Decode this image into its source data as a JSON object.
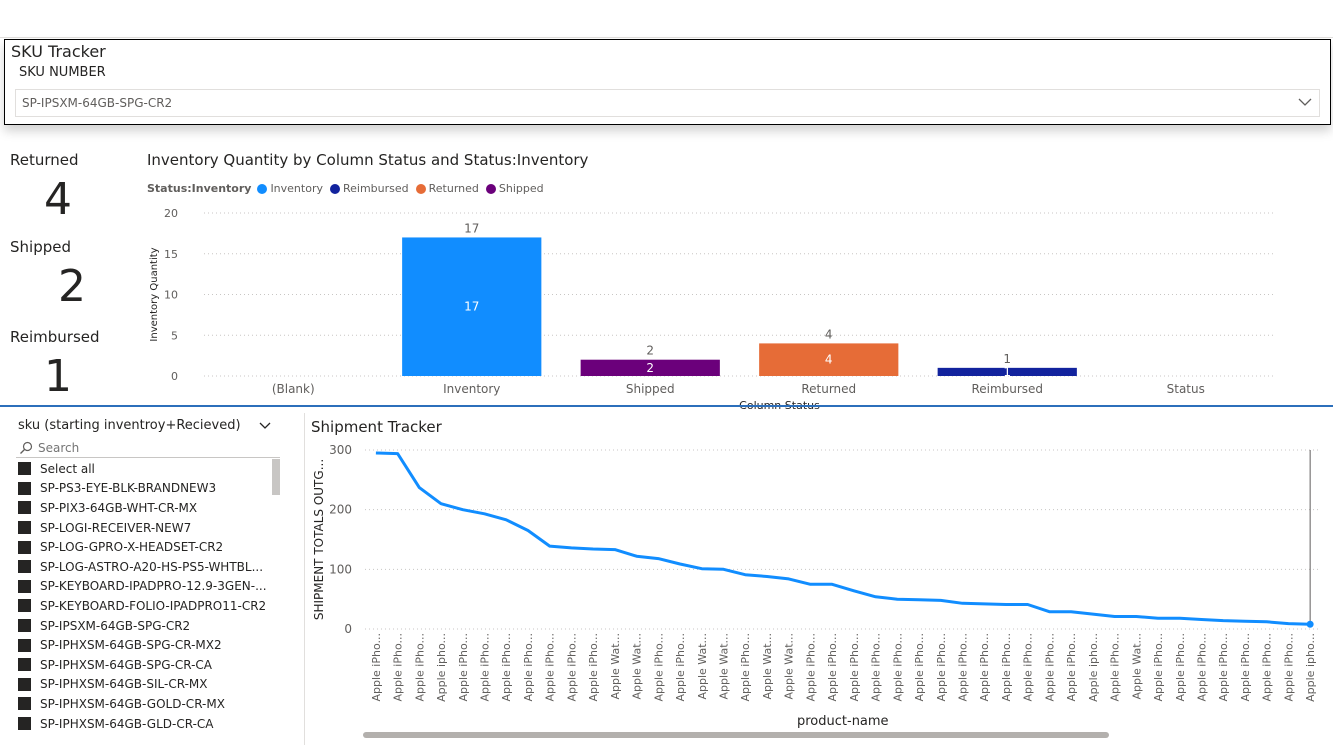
{
  "sku_tracker": {
    "title": "SKU Tracker",
    "label": "SKU NUMBER",
    "selected": "SP-IPSXM-64GB-SPG-CR2"
  },
  "cards": [
    {
      "label": "Returned",
      "value": "4"
    },
    {
      "label": "Shipped",
      "value": "2"
    },
    {
      "label": "Reimbursed",
      "value": "1"
    }
  ],
  "bar_chart": {
    "title": "Inventory Quantity by Column Status and Status:Inventory",
    "legend_title": "Status:Inventory",
    "legend": [
      {
        "name": "Inventory",
        "color": "#118dff"
      },
      {
        "name": "Reimbursed",
        "color": "#12239e"
      },
      {
        "name": "Returned",
        "color": "#e66c37"
      },
      {
        "name": "Shipped",
        "color": "#6b007b"
      }
    ]
  },
  "sku_list": {
    "header": "sku (starting inventroy+Recieved)",
    "search_placeholder": "Search",
    "items": [
      "Select all",
      "SP-PS3-EYE-BLK-BRANDNEW3",
      "SP-PIX3-64GB-WHT-CR-MX",
      "SP-LOGI-RECEIVER-NEW7",
      "SP-LOG-GPRO-X-HEADSET-CR2",
      "SP-LOG-ASTRO-A20-HS-PS5-WHTBL...",
      "SP-KEYBOARD-IPADPRO-12.9-3GEN-...",
      "SP-KEYBOARD-FOLIO-IPADPRO11-CR2",
      "SP-IPSXM-64GB-SPG-CR2",
      "SP-IPHXSM-64GB-SPG-CR-MX2",
      "SP-IPHXSM-64GB-SPG-CR-CA",
      "SP-IPHXSM-64GB-SIL-CR-MX",
      "SP-IPHXSM-64GB-GOLD-CR-MX",
      "SP-IPHXSM-64GB-GLD-CR-CA"
    ]
  },
  "shipment": {
    "title": "Shipment Tracker",
    "xlabel": "product-name"
  },
  "chart_data": [
    {
      "type": "bar",
      "title": "Inventory Quantity by Column Status and Status:Inventory",
      "xlabel": "Column Status",
      "ylabel": "Inventory Quantity",
      "ylim": [
        0,
        20
      ],
      "yticks": [
        0,
        5,
        10,
        15,
        20
      ],
      "categories": [
        "(Blank)",
        "Inventory",
        "Shipped",
        "Returned",
        "Reimbursed",
        "Status"
      ],
      "series": [
        {
          "name": "Inventory",
          "color": "#118dff",
          "values": [
            null,
            17,
            null,
            null,
            null,
            null
          ]
        },
        {
          "name": "Shipped",
          "color": "#6b007b",
          "values": [
            null,
            null,
            2,
            null,
            null,
            null
          ]
        },
        {
          "name": "Returned",
          "color": "#e66c37",
          "values": [
            null,
            null,
            null,
            4,
            null,
            null
          ]
        },
        {
          "name": "Reimbursed",
          "color": "#12239e",
          "values": [
            null,
            null,
            null,
            null,
            1,
            null
          ]
        }
      ],
      "grid": true,
      "legend": "top-left"
    },
    {
      "type": "line",
      "title": "Shipment Tracker",
      "xlabel": "product-name",
      "ylabel": "SHIPMENT TOTALS OUTG...",
      "ylim": [
        0,
        300
      ],
      "yticks": [
        0,
        100,
        200,
        300
      ],
      "color": "#118dff",
      "categories": [
        "Apple iPho...",
        "Apple iPho...",
        "Apple iPho...",
        "Apple ipho...",
        "Apple iPho...",
        "Apple iPho...",
        "Apple iPho...",
        "Apple iPho...",
        "Apple iPho...",
        "Apple iPho...",
        "Apple iPho...",
        "Apple Wat...",
        "Apple Wat...",
        "Apple iPho...",
        "Apple iPho...",
        "Apple Wat...",
        "Apple Wat...",
        "Apple iPho...",
        "Apple Wat...",
        "Apple Wat...",
        "Apple iPho...",
        "Apple iPho...",
        "Apple iPho...",
        "Apple iPho...",
        "Apple iPho...",
        "Apple iPho...",
        "Apple iPho...",
        "Apple iPho...",
        "Apple iPho...",
        "Apple iPho...",
        "Apple iPho...",
        "Apple iPho...",
        "Apple iPho...",
        "Apple ipho...",
        "Apple iPho...",
        "Apple Wat...",
        "Apple iPho...",
        "Apple iPho...",
        "Apple iPho...",
        "Apple iPho...",
        "Apple iPho...",
        "Apple iPho...",
        "Apple iPho...",
        "Apple ipho..."
      ],
      "values": [
        295,
        294,
        237,
        210,
        200,
        193,
        183,
        165,
        139,
        136,
        134,
        133,
        122,
        118,
        109,
        101,
        100,
        91,
        88,
        84,
        75,
        75,
        64,
        54,
        50,
        49,
        48,
        43,
        42,
        41,
        41,
        29,
        29,
        25,
        21,
        21,
        18,
        18,
        16,
        14,
        13,
        12,
        9,
        8
      ],
      "grid": true
    }
  ]
}
